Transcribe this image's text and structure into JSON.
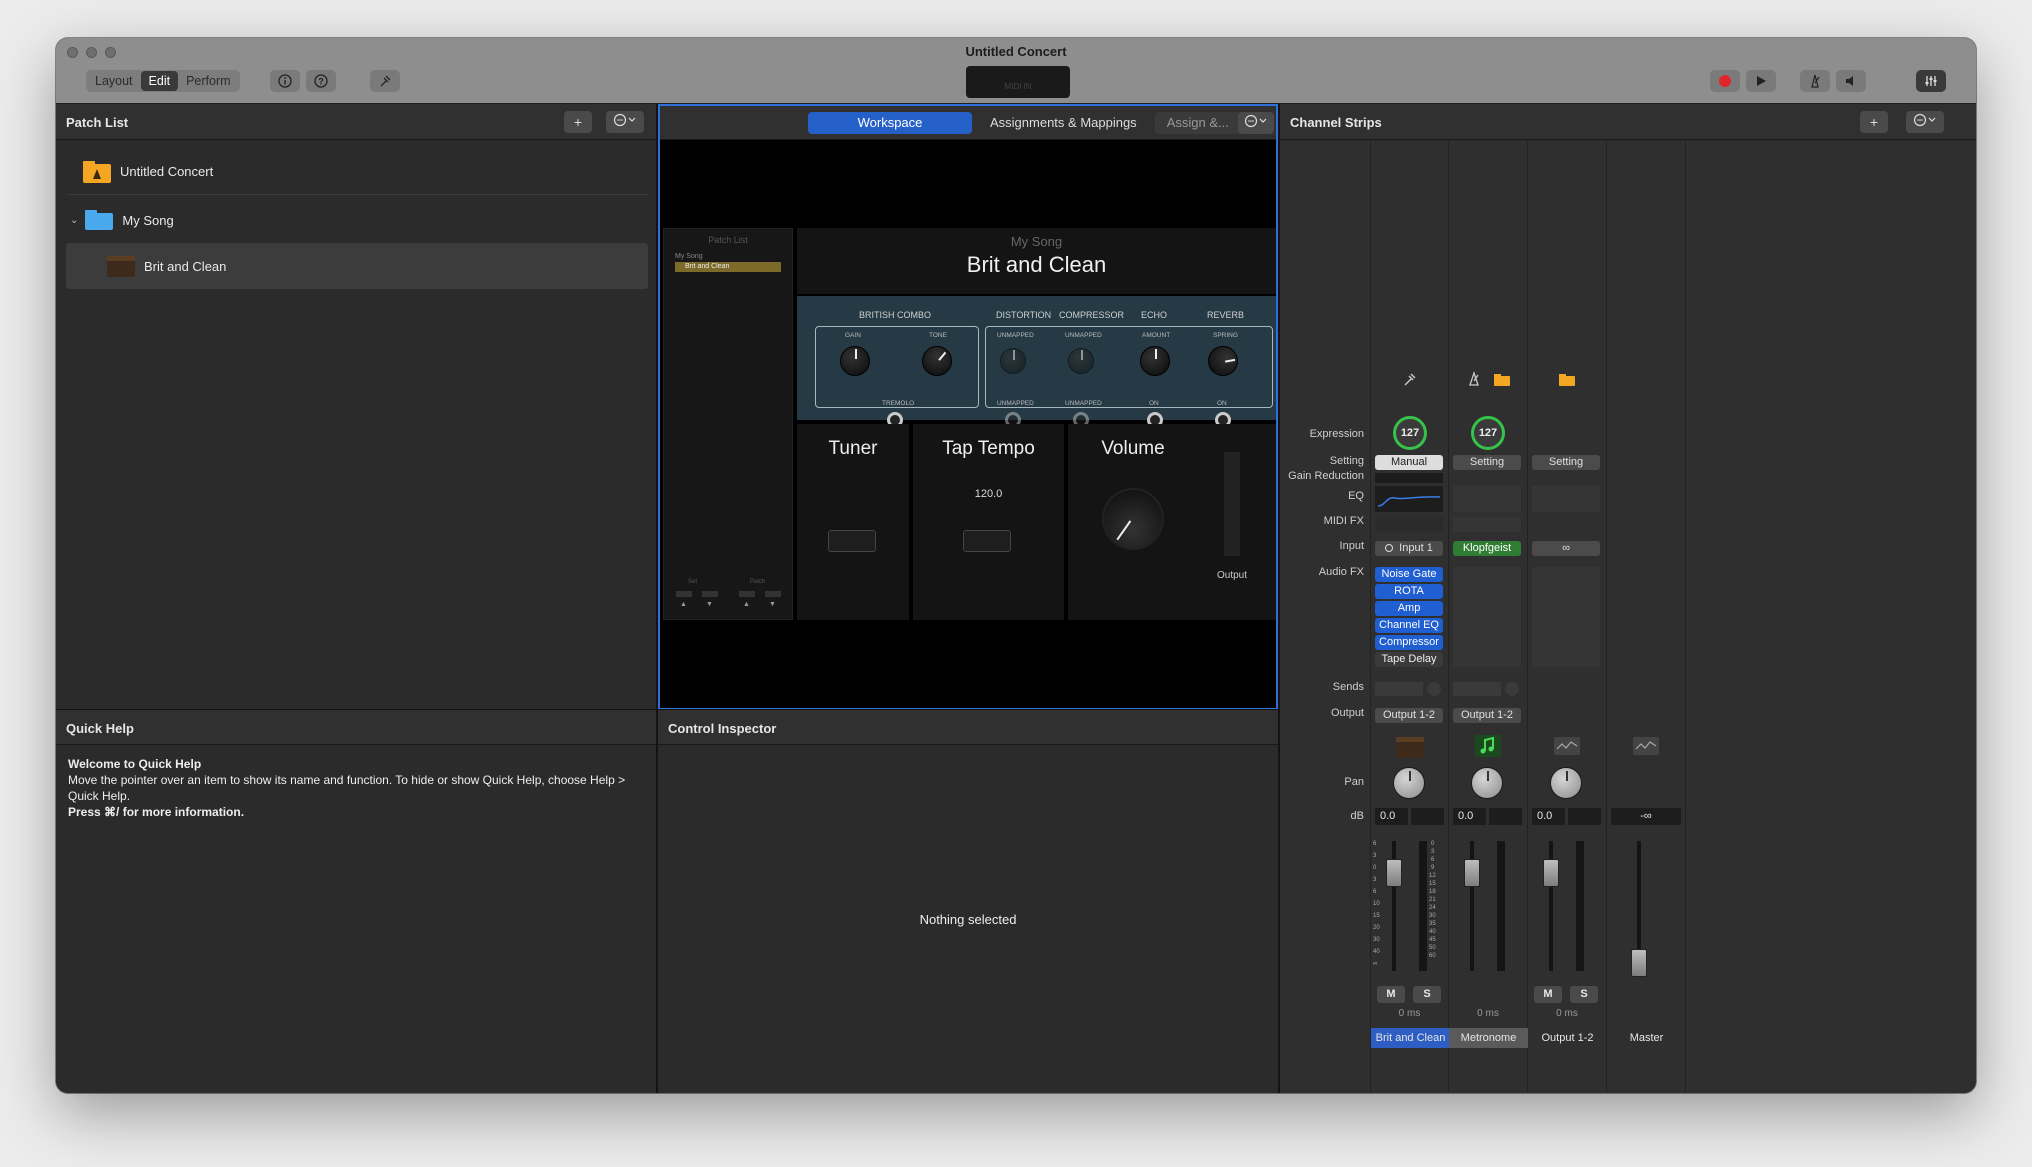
{
  "window": {
    "title": "Untitled Concert"
  },
  "toolbar": {
    "modes": [
      "Layout",
      "Edit",
      "Perform"
    ],
    "active_mode": "Edit",
    "info_icon": "info-icon",
    "help_icon": "help-icon",
    "tuning_icon": "tuning-fork-icon",
    "midi_label": "MIDI IN",
    "record_icon": "record-icon",
    "play_icon": "play-icon",
    "metronome_icon": "metronome-icon",
    "speaker_icon": "speaker-icon",
    "mixer_icon": "mixer-icon"
  },
  "patch_list": {
    "title": "Patch List",
    "add_label": "+",
    "items": [
      {
        "label": "Untitled Concert",
        "icon": "concert-icon"
      },
      {
        "label": "My Song",
        "icon": "folder-icon"
      },
      {
        "label": "Brit and Clean",
        "icon": "patch-icon"
      }
    ]
  },
  "workspace": {
    "tabs": [
      "Workspace",
      "Assignments & Mappings",
      "Assign &..."
    ],
    "mini_patch_list_title": "Patch List",
    "mini_song": "My Song",
    "mini_patch": "Brit and Clean",
    "mini_set": "Set",
    "mini_patch_label": "Patch",
    "song_title": "My Song",
    "patch_title": "Brit and Clean",
    "amp": {
      "sections": [
        "BRITISH COMBO",
        "DISTORTION",
        "COMPRESSOR",
        "ECHO",
        "REVERB"
      ],
      "gain": "GAIN",
      "tone": "TONE",
      "tremolo": "TREMOLO",
      "unmapped": "UNMAPPED",
      "amount": "AMOUNT",
      "spring": "SPRING",
      "on": "ON"
    },
    "tuner": "Tuner",
    "tap_tempo": "Tap Tempo",
    "tempo_value": "120.0",
    "volume": "Volume",
    "output": "Output"
  },
  "channel_strips": {
    "title": "Channel Strips",
    "labels": {
      "expression": "Expression",
      "setting": "Setting",
      "gain_reduction": "Gain Reduction",
      "eq": "EQ",
      "midi_fx": "MIDI FX",
      "input": "Input",
      "audio_fx": "Audio FX",
      "sends": "Sends",
      "output": "Output",
      "pan": "Pan",
      "db": "dB"
    },
    "strips": [
      {
        "name": "Brit and Clean",
        "expression": "127",
        "setting": "Manual",
        "input": "Input 1",
        "audio_fx": [
          "Noise Gate",
          "ROTA",
          "Amp",
          "Channel EQ",
          "Compressor",
          "Tape Delay"
        ],
        "output": "Output 1-2",
        "db": "0.0",
        "mute": "M",
        "solo": "S",
        "latency": "0 ms"
      },
      {
        "name": "Metronome",
        "expression": "127",
        "setting": "Setting",
        "input": "Klopfgeist",
        "audio_fx": [],
        "output": "Output 1-2",
        "db": "0.0",
        "latency": "0 ms"
      },
      {
        "name": "Output 1-2",
        "setting": "Setting",
        "input": "∞",
        "db": "0.0",
        "mute": "M",
        "solo": "S",
        "latency": "0 ms"
      },
      {
        "name": "Master",
        "db": "-∞"
      }
    ],
    "scale_left": [
      "6",
      "3",
      "0",
      "3",
      "6",
      "10",
      "15",
      "20",
      "30",
      "40",
      "∞"
    ],
    "scale_right": [
      "0",
      "3",
      "6",
      "9",
      "12",
      "15",
      "18",
      "21",
      "24",
      "30",
      "35",
      "40",
      "45",
      "50",
      "60"
    ]
  },
  "quick_help": {
    "title": "Quick Help",
    "heading": "Welcome to Quick Help",
    "body": "Move the pointer over an item to show its name and function. To hide or show Quick Help, choose Help > Quick Help.",
    "footer": "Press ⌘/ for more information."
  },
  "control_inspector": {
    "title": "Control Inspector",
    "empty": "Nothing selected"
  },
  "colors": {
    "accent_blue": "#2560c9",
    "expression_green": "#37c24b",
    "record_red": "#e0262a"
  }
}
